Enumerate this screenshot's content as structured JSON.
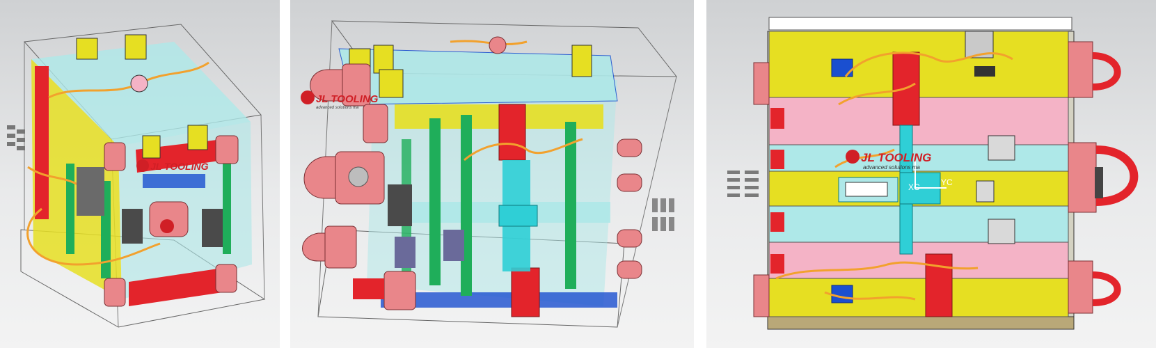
{
  "views": [
    {
      "name": "isometric-view-left"
    },
    {
      "name": "isometric-view-right"
    },
    {
      "name": "top-view"
    }
  ],
  "brand": {
    "logo_text": "JL TOOLING",
    "tagline": "advanced solutions ma"
  },
  "axes": {
    "x_label": "XC",
    "y_label": "YC"
  },
  "colors": {
    "plate_yellow": "#e6df22",
    "plate_pink": "#f4b3c6",
    "plate_cyan": "#aee8e8",
    "plate_red": "#e3242b",
    "salmon": "#e9868a",
    "cooling_orange": "#f2a12d",
    "green_pin": "#1fae5a",
    "brand_red": "#d01f26"
  }
}
